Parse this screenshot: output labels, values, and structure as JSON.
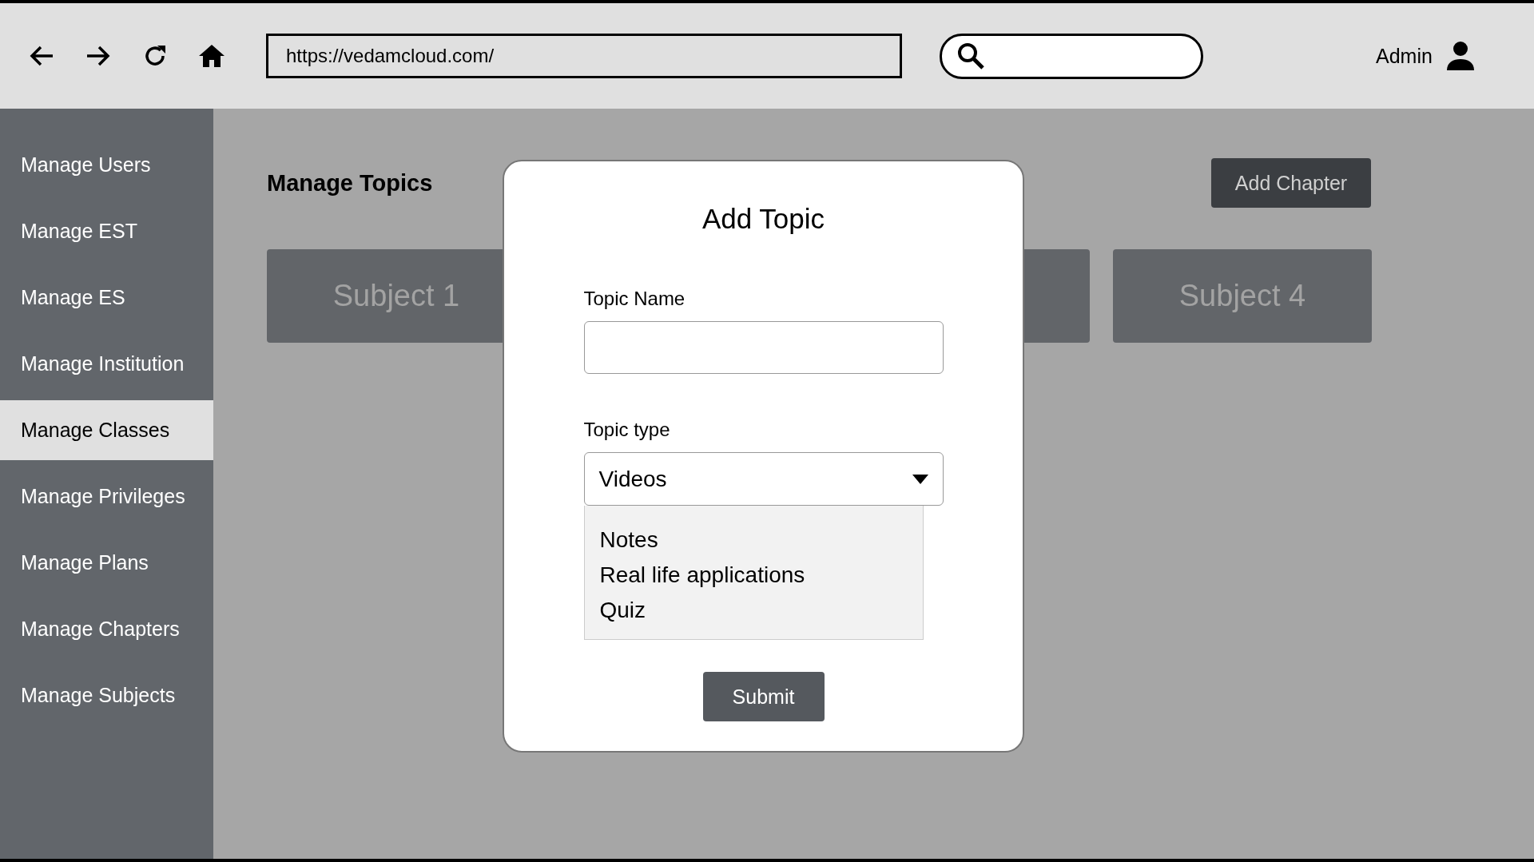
{
  "browser": {
    "url": "https://vedamcloud.com/",
    "user": "Admin"
  },
  "sidebar": {
    "items": [
      {
        "label": "Manage Users",
        "selected": false
      },
      {
        "label": "Manage EST",
        "selected": false
      },
      {
        "label": "Manage ES",
        "selected": false
      },
      {
        "label": "Manage Institution",
        "selected": false
      },
      {
        "label": "Manage Classes",
        "selected": true
      },
      {
        "label": "Manage Privileges",
        "selected": false
      },
      {
        "label": "Manage Plans",
        "selected": false
      },
      {
        "label": "Manage Chapters",
        "selected": false
      },
      {
        "label": "Manage Subjects",
        "selected": false
      }
    ]
  },
  "page": {
    "title": "Manage Topics",
    "action": "Add Chapter",
    "subjects": [
      "Subject 1",
      "Subject 4"
    ]
  },
  "dialog": {
    "title": "Add Topic",
    "fields": [
      {
        "kind": "text",
        "label": "Topic Name"
      },
      {
        "kind": "select",
        "label": "Topic type",
        "value": "Videos",
        "expanded": true,
        "options": [
          "Notes",
          "Real life applications",
          "Quiz"
        ]
      }
    ],
    "submit": "Submit"
  }
}
